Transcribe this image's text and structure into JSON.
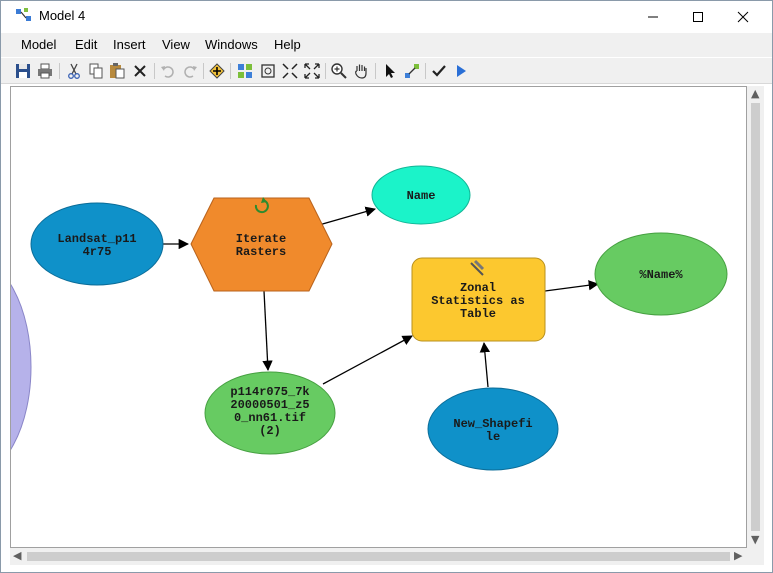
{
  "window": {
    "title": "Model 4"
  },
  "menu": [
    "Model",
    "Edit",
    "Insert",
    "View",
    "Windows",
    "Help"
  ],
  "toolbar": {
    "buttons": [
      "save-icon",
      "print-icon",
      "cut-icon",
      "copy-icon",
      "paste-icon",
      "delete-icon",
      "undo-icon",
      "redo-icon",
      "add-data-icon",
      "auto-layout-icon",
      "full-extent-icon",
      "fixed-zoom-in-icon",
      "fixed-zoom-out-icon",
      "zoom-in-icon",
      "pan-icon",
      "select-icon",
      "connect-icon",
      "validate-icon",
      "run-icon"
    ]
  },
  "model": {
    "nodes": {
      "landsat": {
        "lines": [
          "Landsat_p11",
          "4r75"
        ],
        "color": "#0f91c9"
      },
      "iterate": {
        "lines": [
          "Iterate",
          "Rasters"
        ],
        "color": "#f08a2c"
      },
      "name": {
        "lines": [
          "Name"
        ],
        "color": "#1bf3c9"
      },
      "raster_out": {
        "lines": [
          "p114r075_7k",
          "20000501_z5",
          "0_nn61.tif",
          "(2)"
        ],
        "color": "#67cb62"
      },
      "zonal": {
        "lines": [
          "Zonal",
          "Statistics as",
          "Table"
        ],
        "color": "#fcc82f"
      },
      "name_out": {
        "lines": [
          "%Name%"
        ],
        "color": "#67cb62"
      },
      "shapefile": {
        "lines": [
          "New_Shapefi",
          "le"
        ],
        "color": "#0f91c9"
      }
    }
  }
}
